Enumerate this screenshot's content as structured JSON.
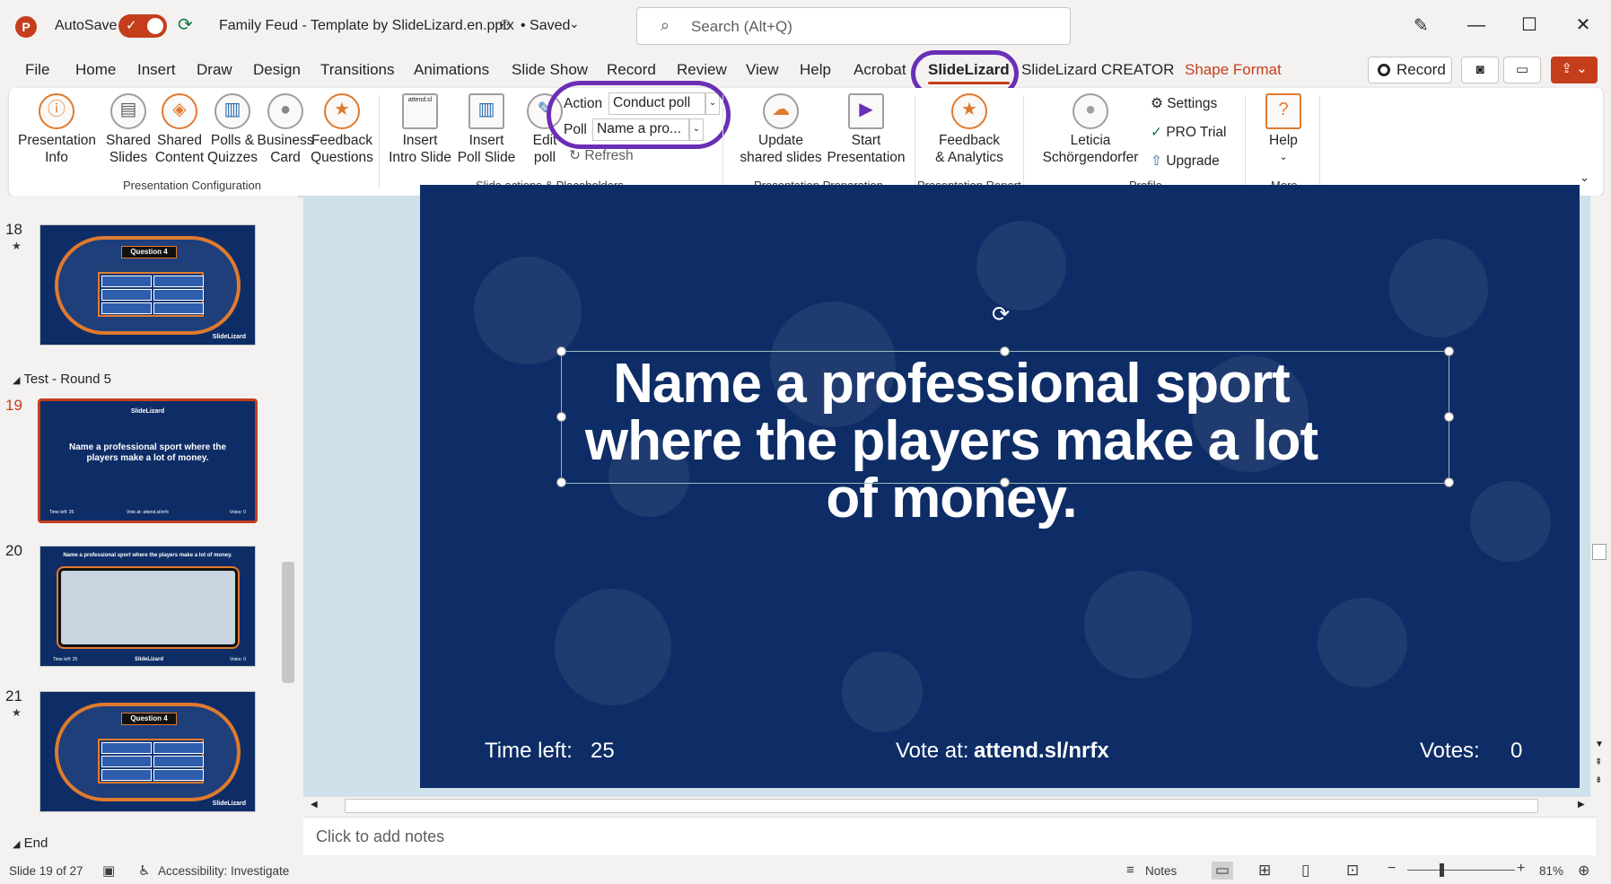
{
  "titlebar": {
    "app_letter": "P",
    "autosave_label": "AutoSave",
    "file_name": "Family Feud - Template by SlideLizard.en.pptx",
    "saved_status": "• Saved",
    "search_placeholder": "Search (Alt+Q)"
  },
  "tabs": [
    "File",
    "Home",
    "Insert",
    "Draw",
    "Design",
    "Transitions",
    "Animations",
    "Slide Show",
    "Record",
    "Review",
    "View",
    "Help",
    "Acrobat",
    "SlideLizard",
    "SlideLizard CREATOR",
    "Shape Format"
  ],
  "active_tab": "SlideLizard",
  "record_button": "Record",
  "ribbon": {
    "presentation_info": "Presentation\nInfo",
    "shared_slides": "Shared\nSlides",
    "shared_content": "Shared\nContent",
    "polls_quizzes": "Polls &\nQuizzes",
    "business_card": "Business\nCard",
    "feedback_questions": "Feedback\nQuestions",
    "group_config": "Presentation Configuration",
    "insert_intro": "Insert\nIntro Slide",
    "insert_poll": "Insert\nPoll Slide",
    "edit_poll": "Edit\npoll",
    "action_label": "Action",
    "action_value": "Conduct poll",
    "poll_label": "Poll",
    "poll_value": "Name a pro...",
    "refresh": "Refresh",
    "intro_icon_text": "attend.sl",
    "group_slide_actions": "Slide actions & Placeholders",
    "update_shared": "Update\nshared slides",
    "start_presentation": "Start\nPresentation",
    "group_preparation": "Presentation Preparation",
    "feedback_analytics": "Feedback\n& Analytics",
    "group_report": "Presentation Report",
    "profile_name": "Leticia\nSchörgendorfer",
    "settings": "Settings",
    "pro_trial": "PRO Trial",
    "upgrade": "Upgrade",
    "group_profile": "Profile",
    "help": "Help",
    "group_more": "More"
  },
  "thumbnails": {
    "slide18_num": "18",
    "slide18_title": "Question 4",
    "section_name": "Test - Round 5",
    "slide19_num": "19",
    "slide19_logo": "SlideLizard",
    "slide19_title": "Name a professional sport where the players make a lot of money.",
    "slide19_footer_left": "Time left:    25",
    "slide19_footer_mid": "Vote at: attend.sl/nrfx",
    "slide19_footer_right": "Votes:    0",
    "slide20_num": "20",
    "slide20_title": "Name a professional sport where the players make a lot of money.",
    "slide20_footer_left": "Time left:    25",
    "slide20_footer_right": "Votes:    0",
    "slide21_num": "21",
    "slide21_title": "Question 4",
    "end_section": "End",
    "logo_text": "SlideLizard"
  },
  "slide": {
    "title": "Name a professional sport where the players make a lot of money.",
    "time_left_label": "Time left:",
    "time_left_value": "25",
    "vote_prefix": "Vote at: ",
    "vote_url": "attend.sl/nrfx",
    "votes_label": "Votes:",
    "votes_value": "0"
  },
  "notes_placeholder": "Click to add notes",
  "status": {
    "slide_counter": "Slide 19 of 27",
    "accessibility": "Accessibility: Investigate",
    "notes": "Notes",
    "zoom": "81%"
  },
  "colors": {
    "accent": "#c43e1c",
    "highlight_circle": "#6a2fb5",
    "slide_bg": "#0e2d66"
  }
}
